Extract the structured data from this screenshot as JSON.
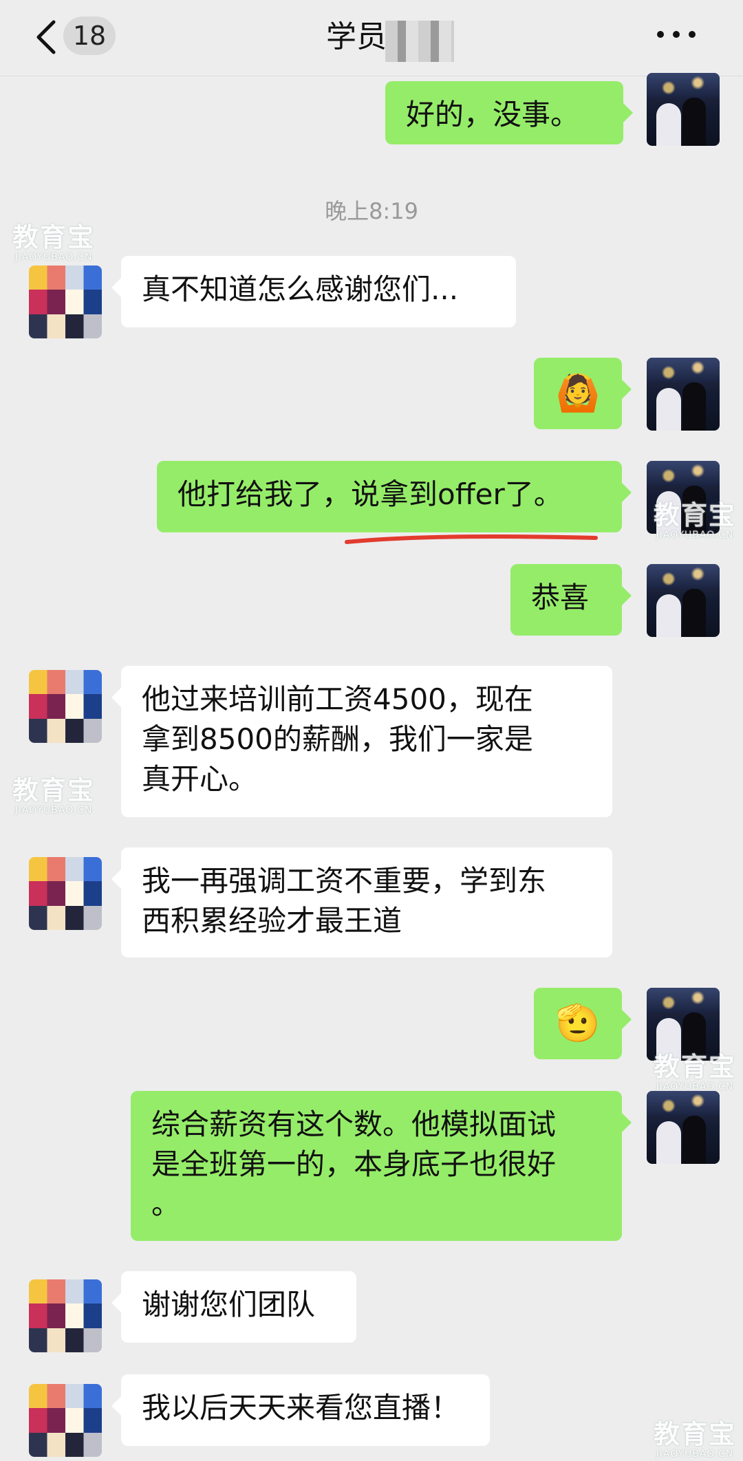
{
  "header": {
    "title": "学员黄",
    "unread_count": "18"
  },
  "timestamp": "晚上8:19",
  "messages": [
    {
      "text": "好的，没事。"
    },
    {
      "text": "真不知道怎么感谢您们..."
    },
    {
      "text": "🙆",
      "icon": "person-gesture-emoji"
    },
    {
      "text": "他打给我了，说拿到offer了。"
    },
    {
      "text": "恭喜"
    },
    {
      "text": "他过来培训前工资4500，现在\n拿到8500的薪酬，我们一家是\n真开心。"
    },
    {
      "text": "我一再强调工资不重要，学到东\n西积累经验才最王道"
    },
    {
      "text": "🫡",
      "icon": "saluting-face-emoji"
    },
    {
      "text": "综合薪资有这个数。他模拟面试\n是全班第一的，本身底子也很好\n。"
    },
    {
      "text": "谢谢您们团队"
    },
    {
      "text": "我以后天天来看您直播！"
    }
  ],
  "watermark": {
    "cn": "教育宝",
    "en": "JIAOYUBAO.CN"
  },
  "colors": {
    "outgoing_bubble": "#95ec69",
    "incoming_bubble": "#ffffff",
    "background": "#ededed",
    "highlight_underline": "#e23b2e"
  }
}
